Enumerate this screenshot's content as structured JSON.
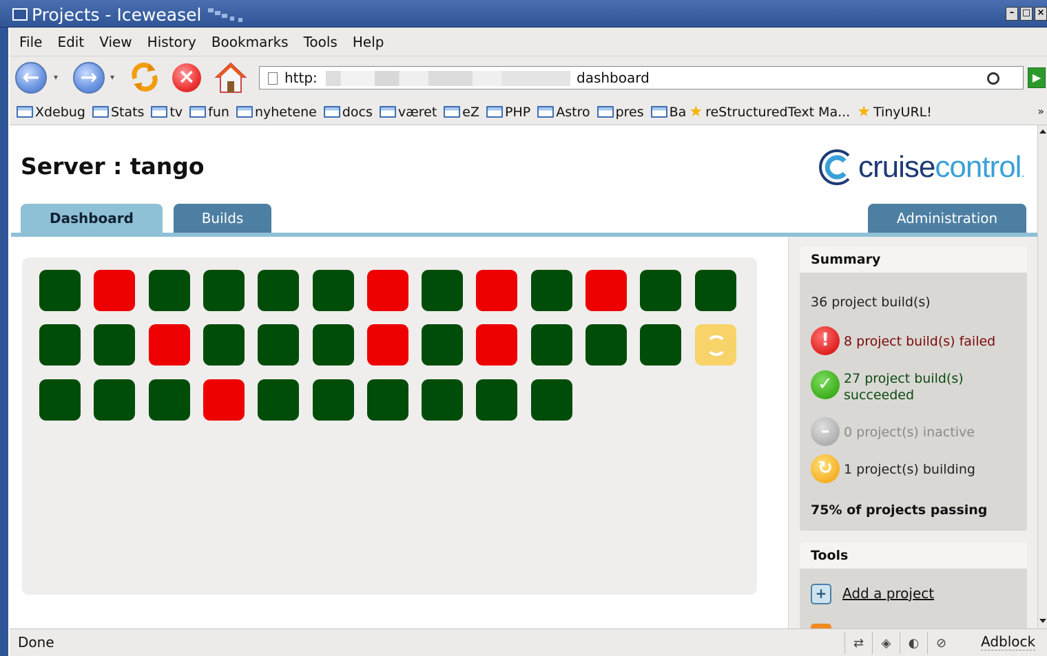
{
  "window": {
    "title": "Projects - Iceweasel"
  },
  "menu": [
    "File",
    "Edit",
    "View",
    "History",
    "Bookmarks",
    "Tools",
    "Help"
  ],
  "toolbar": {
    "url_prefix": "http:",
    "url_suffix": "dashboard"
  },
  "bookmarks": {
    "folders": [
      "Xdebug",
      "Stats",
      "tv",
      "fun",
      "nyhetene",
      "docs",
      "været",
      "eZ",
      "PHP",
      "Astro",
      "pres",
      "Ba"
    ],
    "starred": [
      "reStructuredText Ma...",
      "TinyURL!"
    ],
    "more": "»"
  },
  "page": {
    "server_title": "Server : tango",
    "logo": {
      "cruise": "cruise",
      "control": "control",
      "dot": "."
    },
    "tabs": {
      "dashboard": "Dashboard",
      "builds": "Builds",
      "administration": "Administration"
    },
    "projects": [
      "pass",
      "fail",
      "pass",
      "pass",
      "pass",
      "pass",
      "fail",
      "pass",
      "fail",
      "pass",
      "fail",
      "pass",
      "pass",
      "pass",
      "pass",
      "fail",
      "pass",
      "pass",
      "pass",
      "fail",
      "pass",
      "fail",
      "pass",
      "pass",
      "pass",
      "building",
      "pass",
      "pass",
      "pass",
      "fail",
      "pass",
      "pass",
      "pass",
      "pass",
      "pass",
      "pass"
    ],
    "summary": {
      "title": "Summary",
      "total": "36 project build(s)",
      "failed": "8 project build(s) failed",
      "succeeded_1": "27 project build(s)",
      "succeeded_2": "succeeded",
      "inactive": "0 project(s) inactive",
      "building": "1 project(s) building",
      "passing": "75% of projects passing"
    },
    "tools": {
      "title": "Tools",
      "add_project": "Add a project"
    }
  },
  "statusbar": {
    "status": "Done",
    "adblock": "Adblock"
  }
}
